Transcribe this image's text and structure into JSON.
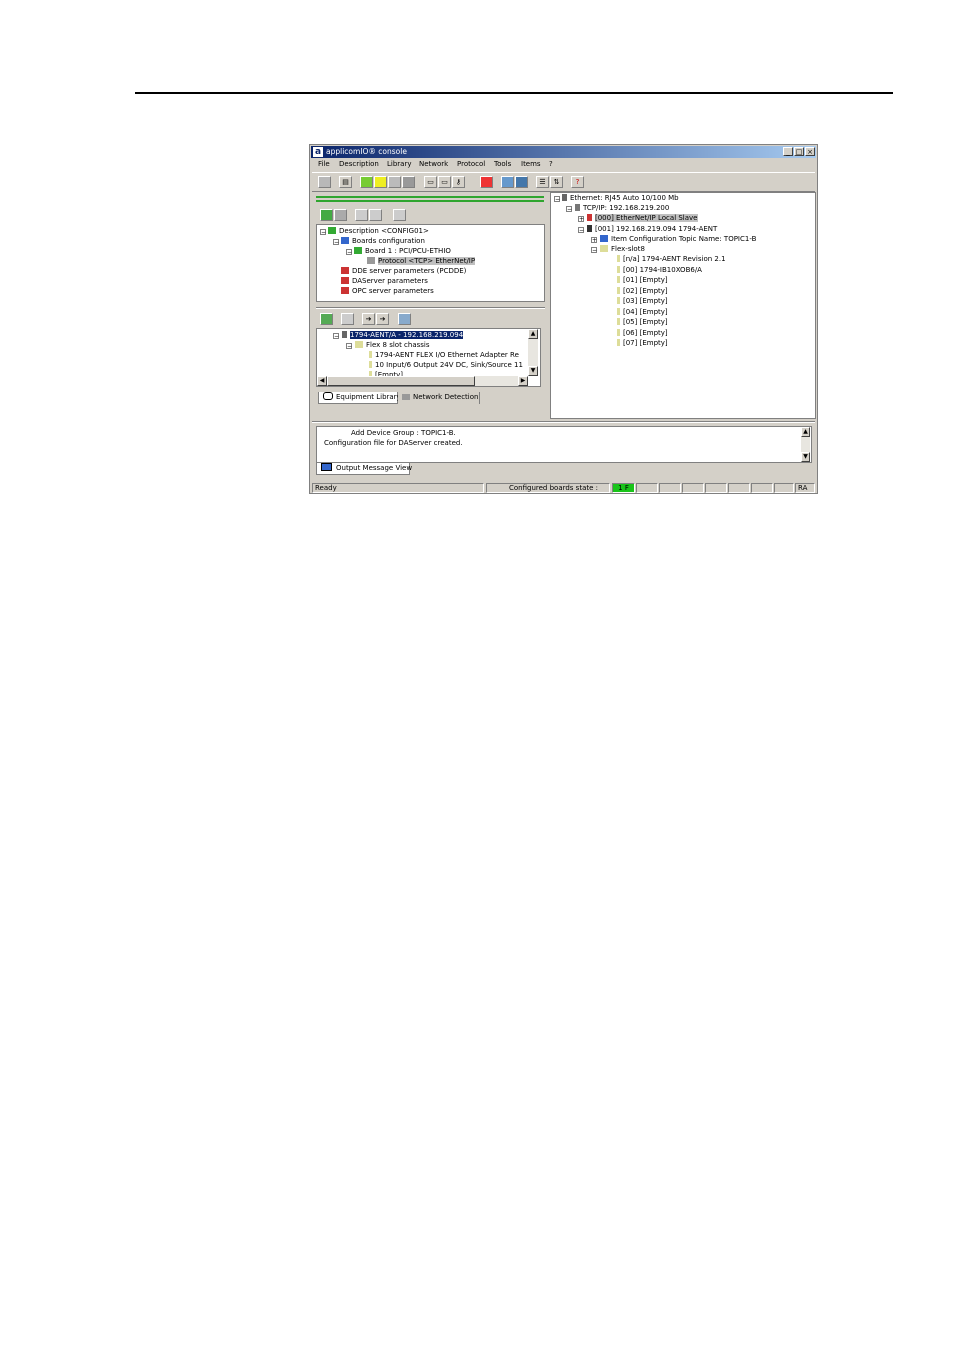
{
  "window": {
    "title": "applicomIO® console",
    "menu": [
      "File",
      "Description",
      "Library",
      "Network",
      "Protocol",
      "Tools",
      "Items",
      "?"
    ]
  },
  "config_tree": [
    {
      "label": "Description <CONFIG01>",
      "icon": "config-icon"
    },
    {
      "label": "Boards configuration",
      "icon": "boards-icon"
    },
    {
      "label": "Board 1 :   PCI/PCU-ETHIO",
      "icon": "board-icon"
    },
    {
      "label": "Protocol <TCP> EtherNet/IP",
      "icon": "protocol-icon"
    },
    {
      "label": "DDE server parameters (PCDDE)",
      "icon": "dde-icon"
    },
    {
      "label": "DAServer parameters",
      "icon": "daserver-icon"
    },
    {
      "label": "OPC server parameters",
      "icon": "opc-icon"
    }
  ],
  "equipment_tree": [
    {
      "label": "1794-AENT/A - 192.168.219.094"
    },
    {
      "label": "Flex 8 slot chassis"
    },
    {
      "label": "1794-AENT FLEX I/O Ethernet Adapter Re"
    },
    {
      "label": "10 Input/6 Output 24V DC, Sink/Source 11"
    },
    {
      "label": "[Empty]"
    }
  ],
  "tabs": {
    "equipment": "Equipment Library",
    "network": "Network Detection",
    "output": "Output Message View"
  },
  "network_tree": [
    {
      "label": "Ethernet: RJ45 Auto 10/100 Mb"
    },
    {
      "label": "TCP/IP: 192.168.219.200"
    },
    {
      "label": "[000] EtherNet/IP Local Slave"
    },
    {
      "label": "[001] 192.168.219.094   1794-AENT"
    },
    {
      "label": "Item Configuration  Topic Name: TOPIC1-B"
    },
    {
      "label": "Flex-slot8"
    },
    {
      "label": "[n/a] 1794-AENT Revision 2.1"
    },
    {
      "label": "[00] 1794-IB10XOB6/A"
    },
    {
      "label": "[01] [Empty]"
    },
    {
      "label": "[02] [Empty]"
    },
    {
      "label": "[03] [Empty]"
    },
    {
      "label": "[04] [Empty]"
    },
    {
      "label": "[05] [Empty]"
    },
    {
      "label": "[06] [Empty]"
    },
    {
      "label": "[07] [Empty]"
    }
  ],
  "output": {
    "line1": "Add Device Group : TOPIC1-B.",
    "line2": "Configuration file for DAServer created."
  },
  "status": {
    "ready": "Ready",
    "boards_state": "Configured boards state :",
    "board1": "1 F",
    "caps": "RA"
  }
}
